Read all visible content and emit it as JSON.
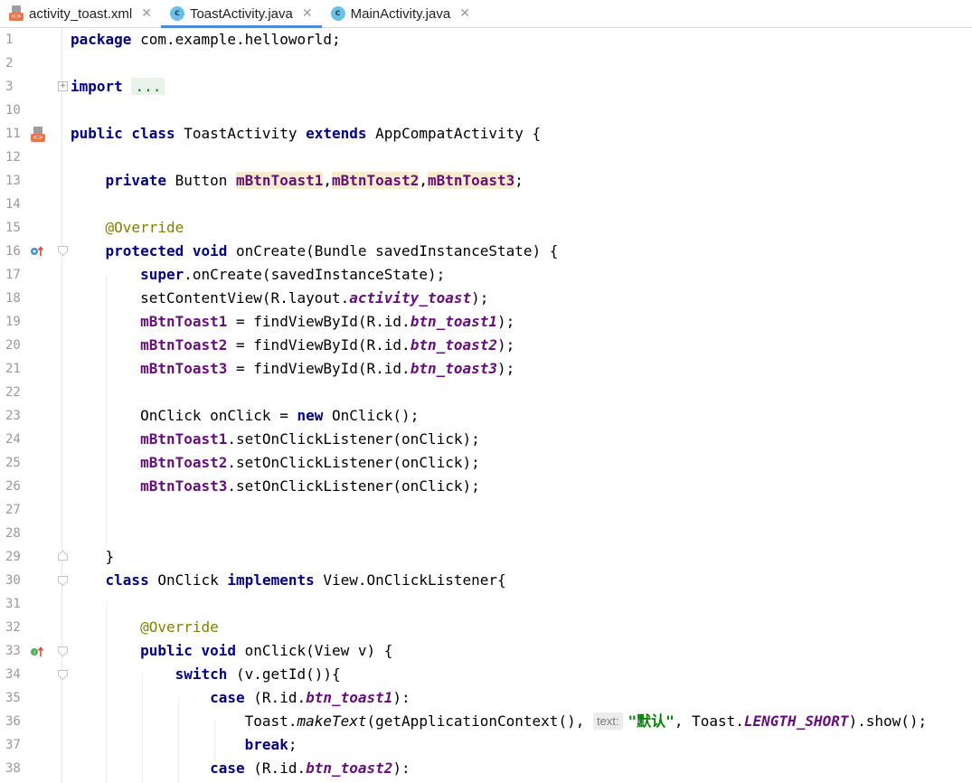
{
  "tabs": [
    {
      "label": "activity_toast.xml",
      "icon": "xml-file-icon",
      "active": false
    },
    {
      "label": "ToastActivity.java",
      "icon": "java-class-icon",
      "active": true
    },
    {
      "label": "MainActivity.java",
      "icon": "java-class-icon",
      "active": false
    }
  ],
  "colors": {
    "keyword": "#000080",
    "field": "#660e7a",
    "annotation": "#808000",
    "string": "#008000",
    "active_tab_underline": "#4a8fd6",
    "field_highlight": "#f8eccc"
  },
  "lines": [
    {
      "num": "1",
      "parts": [
        [
          "kw",
          "package"
        ],
        [
          "p",
          " com.example.helloworld;"
        ]
      ]
    },
    {
      "num": "2",
      "parts": []
    },
    {
      "num": "3",
      "parts": [
        [
          "kw",
          "import"
        ],
        [
          "p",
          " "
        ],
        [
          "dots",
          "..."
        ]
      ]
    },
    {
      "num": "10",
      "parts": []
    },
    {
      "num": "11",
      "parts": [
        [
          "kw",
          "public class"
        ],
        [
          "p",
          " ToastActivity "
        ],
        [
          "kw",
          "extends"
        ],
        [
          "p",
          " AppCompatActivity {"
        ]
      ]
    },
    {
      "num": "12",
      "parts": []
    },
    {
      "num": "13",
      "parts": [
        [
          "p",
          "    "
        ],
        [
          "kw",
          "private"
        ],
        [
          "p",
          " Button "
        ],
        [
          "fldhl",
          "mBtnToast1"
        ],
        [
          "p",
          ","
        ],
        [
          "fldhl",
          "mBtnToast2"
        ],
        [
          "p",
          ","
        ],
        [
          "fldhl",
          "mBtnToast3"
        ],
        [
          "p",
          ";"
        ]
      ]
    },
    {
      "num": "14",
      "parts": []
    },
    {
      "num": "15",
      "parts": [
        [
          "p",
          "    "
        ],
        [
          "ann",
          "@Override"
        ]
      ]
    },
    {
      "num": "16",
      "parts": [
        [
          "p",
          "    "
        ],
        [
          "kw",
          "protected void"
        ],
        [
          "p",
          " onCreate(Bundle savedInstanceState) {"
        ]
      ]
    },
    {
      "num": "17",
      "parts": [
        [
          "p",
          "        "
        ],
        [
          "kw",
          "super"
        ],
        [
          "p",
          ".onCreate(savedInstanceState);"
        ]
      ]
    },
    {
      "num": "18",
      "parts": [
        [
          "p",
          "        setContentView(R.layout."
        ],
        [
          "ital",
          "activity_toast"
        ],
        [
          "p",
          ");"
        ]
      ]
    },
    {
      "num": "19",
      "parts": [
        [
          "p",
          "        "
        ],
        [
          "fld",
          "mBtnToast1"
        ],
        [
          "p",
          " = findViewById(R.id."
        ],
        [
          "ital",
          "btn_toast1"
        ],
        [
          "p",
          ");"
        ]
      ]
    },
    {
      "num": "20",
      "parts": [
        [
          "p",
          "        "
        ],
        [
          "fld",
          "mBtnToast2"
        ],
        [
          "p",
          " = findViewById(R.id."
        ],
        [
          "ital",
          "btn_toast2"
        ],
        [
          "p",
          ");"
        ]
      ]
    },
    {
      "num": "21",
      "parts": [
        [
          "p",
          "        "
        ],
        [
          "fld",
          "mBtnToast3"
        ],
        [
          "p",
          " = findViewById(R.id."
        ],
        [
          "ital",
          "btn_toast3"
        ],
        [
          "p",
          ");"
        ]
      ]
    },
    {
      "num": "22",
      "parts": []
    },
    {
      "num": "23",
      "parts": [
        [
          "p",
          "        OnClick onClick = "
        ],
        [
          "kw",
          "new"
        ],
        [
          "p",
          " OnClick();"
        ]
      ]
    },
    {
      "num": "24",
      "parts": [
        [
          "p",
          "        "
        ],
        [
          "fld",
          "mBtnToast1"
        ],
        [
          "p",
          ".setOnClickListener(onClick);"
        ]
      ]
    },
    {
      "num": "25",
      "parts": [
        [
          "p",
          "        "
        ],
        [
          "fld",
          "mBtnToast2"
        ],
        [
          "p",
          ".setOnClickListener(onClick);"
        ]
      ]
    },
    {
      "num": "26",
      "parts": [
        [
          "p",
          "        "
        ],
        [
          "fld",
          "mBtnToast3"
        ],
        [
          "p",
          ".setOnClickListener(onClick);"
        ]
      ]
    },
    {
      "num": "27",
      "parts": []
    },
    {
      "num": "28",
      "parts": []
    },
    {
      "num": "29",
      "parts": [
        [
          "p",
          "    }"
        ]
      ]
    },
    {
      "num": "30",
      "parts": [
        [
          "p",
          "    "
        ],
        [
          "kw",
          "class"
        ],
        [
          "p",
          " OnClick "
        ],
        [
          "kw",
          "implements"
        ],
        [
          "p",
          " View.OnClickListener{"
        ]
      ]
    },
    {
      "num": "31",
      "parts": []
    },
    {
      "num": "32",
      "parts": [
        [
          "p",
          "        "
        ],
        [
          "ann",
          "@Override"
        ]
      ]
    },
    {
      "num": "33",
      "parts": [
        [
          "p",
          "        "
        ],
        [
          "kw",
          "public void"
        ],
        [
          "p",
          " onClick(View v) {"
        ]
      ]
    },
    {
      "num": "34",
      "parts": [
        [
          "p",
          "            "
        ],
        [
          "kw",
          "switch"
        ],
        [
          "p",
          " (v.getId()){"
        ]
      ]
    },
    {
      "num": "35",
      "parts": [
        [
          "p",
          "                "
        ],
        [
          "kw",
          "case"
        ],
        [
          "p",
          " (R.id."
        ],
        [
          "ital",
          "btn_toast1"
        ],
        [
          "p",
          "):"
        ]
      ]
    },
    {
      "num": "36",
      "parts": [
        [
          "p",
          "                    Toast."
        ],
        [
          "meth",
          "makeText"
        ],
        [
          "p",
          "(getApplicationContext(), "
        ],
        [
          "hint",
          "text:"
        ],
        [
          "str",
          "\"默认\""
        ],
        [
          "p",
          ", Toast."
        ],
        [
          "ital",
          "LENGTH_SHORT"
        ],
        [
          "p",
          ").show();"
        ]
      ]
    },
    {
      "num": "37",
      "parts": [
        [
          "p",
          "                    "
        ],
        [
          "kw",
          "break"
        ],
        [
          "p",
          ";"
        ]
      ]
    },
    {
      "num": "38",
      "parts": [
        [
          "p",
          "                "
        ],
        [
          "kw",
          "case"
        ],
        [
          "p",
          " (R.id."
        ],
        [
          "ital",
          "btn_toast2"
        ],
        [
          "p",
          "):"
        ]
      ]
    }
  ]
}
